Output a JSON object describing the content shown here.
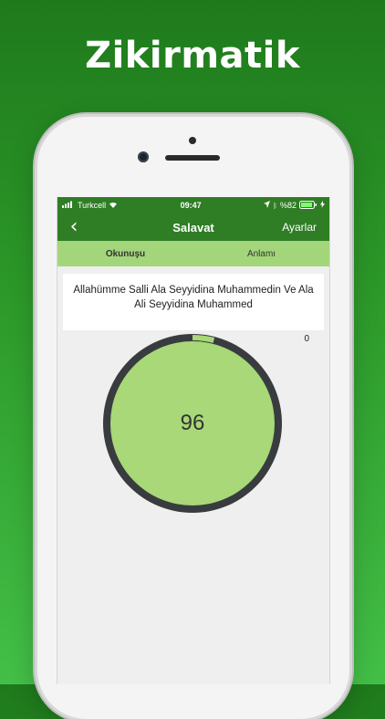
{
  "promo": {
    "title": "Zikirmatik"
  },
  "status_bar": {
    "carrier": "Turkcell",
    "time": "09:47",
    "battery": "%82"
  },
  "nav": {
    "title": "Salavat",
    "settings_label": "Ayarlar"
  },
  "tabs": [
    {
      "label": "Okunuşu",
      "active": true
    },
    {
      "label": "Anlamı",
      "active": false
    }
  ],
  "verse": {
    "text": "Allahümme Salli Ala Seyyidina Muhammedin Ve Ala Ali Seyyidina Muhammed"
  },
  "counter": {
    "count": "96",
    "total_label": "0",
    "progress_fraction": 0.04
  },
  "colors": {
    "accent": "#2f7d25",
    "tab_bg": "#a3d67a",
    "dial_fill": "#a8d878",
    "dial_ring": "#383c3f"
  }
}
